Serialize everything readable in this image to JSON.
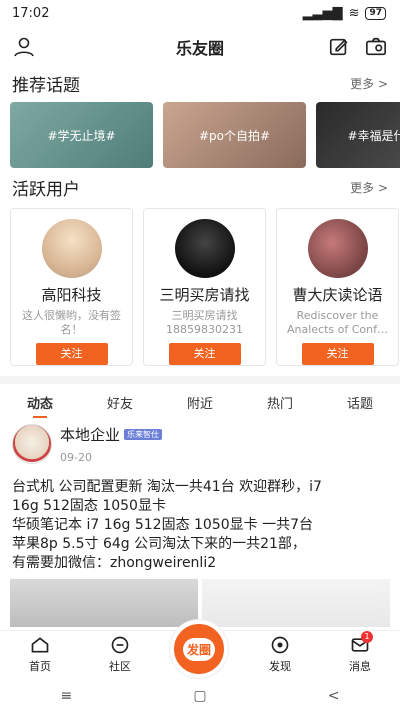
{
  "status_bar": {
    "time": "17:02",
    "signal": "....ıl",
    "wifi": "wifi",
    "battery": "97"
  },
  "header": {
    "title": "乐友圈"
  },
  "topics_section": {
    "heading": "推荐话题",
    "more": "更多 >",
    "items": [
      {
        "label": "#学无止境#"
      },
      {
        "label": "#po个自拍#"
      },
      {
        "label": "#幸福是什么#"
      }
    ]
  },
  "users_section": {
    "heading": "活跃用户",
    "more": "更多 >",
    "items": [
      {
        "name": "高阳科技",
        "desc": "这人很懒哟，没有签名！",
        "follow": "关注"
      },
      {
        "name": "三明买房请找",
        "desc": "三明买房请找 18859830231",
        "follow": "关注"
      },
      {
        "name": "曹大庆读论语",
        "desc": "Rediscover the Analects of Conf…",
        "follow": "关注"
      }
    ]
  },
  "feed_tabs": [
    "动态",
    "好友",
    "附近",
    "热门",
    "话题"
  ],
  "post": {
    "author": "本地企业",
    "badge": "乐来智仕",
    "date": "09-20",
    "text_lines": [
      "台式机 公司配置更新 淘汰一共41台 欢迎群秒，i7",
      "16g 512固态 1050显卡",
      "华硕笔记本 i7 16g 512固态 1050显卡 一共7台",
      "苹果8p 5.5寸 64g 公司淘汰下来的一共21部，",
      "有需要加微信：zhongweirenli2"
    ]
  },
  "bottom_nav": {
    "home": "首页",
    "community": "社区",
    "fab": "发圈",
    "discover": "发现",
    "messages": "消息",
    "messages_badge": "1"
  },
  "system_nav": {
    "menu": "≡",
    "home": "▢",
    "back": "<"
  },
  "colors": {
    "accent": "#f26322"
  }
}
